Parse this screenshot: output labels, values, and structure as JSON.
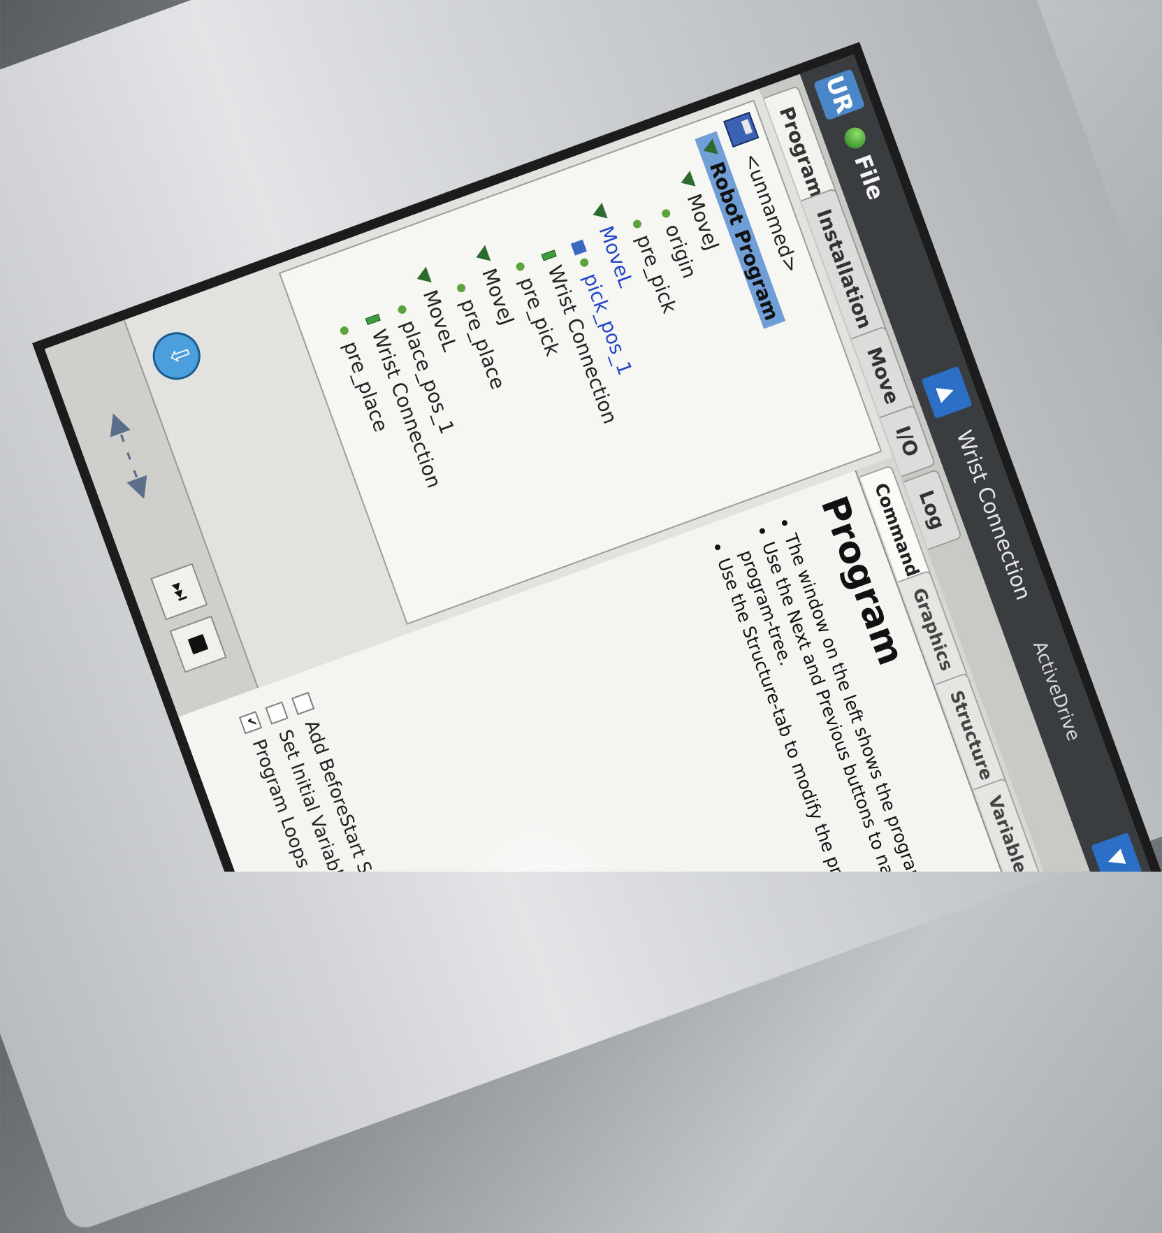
{
  "header": {
    "logo": "UR",
    "file_label": "File",
    "title": "Wrist Connection",
    "active_drive": "ActiveDrive",
    "prev_arrow": "▲",
    "next_arrow": "▼"
  },
  "main_tabs": [
    {
      "label": "Program"
    },
    {
      "label": "Installation"
    },
    {
      "label": "Move"
    },
    {
      "label": "I/O"
    },
    {
      "label": "Log"
    }
  ],
  "program_file": "<unnamed>",
  "tree": [
    {
      "label": "Robot Program"
    },
    {
      "label": "MoveJ"
    },
    {
      "label": "origin"
    },
    {
      "label": "pre_pick"
    },
    {
      "label": "MoveL"
    },
    {
      "label": "pick_pos_1"
    },
    {
      "label": "Wrist Connection"
    },
    {
      "label": "pre_pick"
    },
    {
      "label": "MoveJ"
    },
    {
      "label": "pre_place"
    },
    {
      "label": "MoveL"
    },
    {
      "label": "place_pos_1"
    },
    {
      "label": "Wrist Connection"
    },
    {
      "label": "pre_place"
    }
  ],
  "sub_tabs": [
    {
      "label": "Command"
    },
    {
      "label": "Graphics"
    },
    {
      "label": "Structure"
    },
    {
      "label": "Variables"
    }
  ],
  "command": {
    "title": "Program",
    "bullets": [
      "The window on the left shows the program-tree",
      "Use the Next and Previous buttons to navigate the program-tree.",
      "Use the Structure-tab to modify the program"
    ],
    "options": [
      {
        "label": "Add BeforeStart Sequence",
        "checked": false
      },
      {
        "label": "Set Initial Variable Values",
        "checked": false
      },
      {
        "label": "Program Loops Forever",
        "checked": true
      }
    ]
  },
  "controls": {
    "down_icon": "⇩",
    "nav_icon": "◀- - -▶",
    "step_icon": "⏭",
    "stop_icon": "■"
  },
  "colors": {
    "accent": "#2c6fc7",
    "selected_node": "#2446c8",
    "root_highlight": "#6f9fd6"
  }
}
